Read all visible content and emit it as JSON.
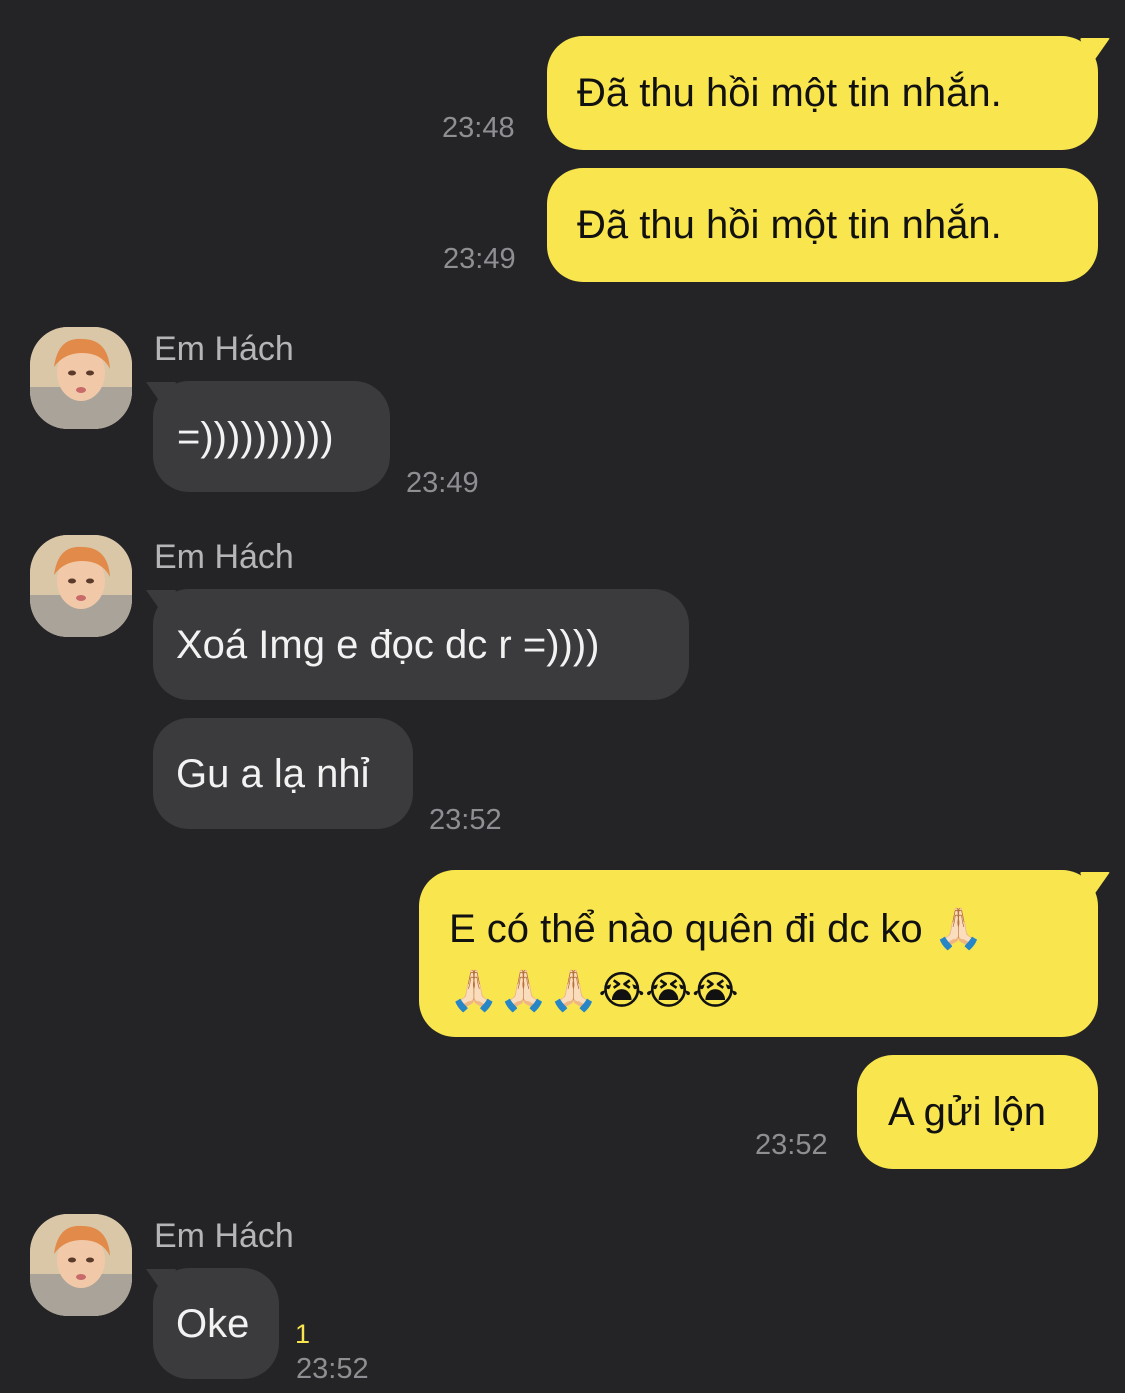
{
  "conversation": {
    "contact_name": "Em Hách",
    "messages": [
      {
        "direction": "out",
        "text": "Đã thu hồi một tin nhắn.",
        "time": "23:48"
      },
      {
        "direction": "out",
        "text": "Đã thu hồi một tin nhắn.",
        "time": "23:49"
      },
      {
        "direction": "in",
        "sender": "Em Hách",
        "text": "=))))))))))",
        "time": "23:49"
      },
      {
        "direction": "in",
        "sender": "Em Hách",
        "text": "Xoá Img e đọc dc r =))))"
      },
      {
        "direction": "in",
        "text": "Gu a lạ nhỉ",
        "time": "23:52"
      },
      {
        "direction": "out",
        "text_line1": "E có thể nào quên đi dc ko 🙏🏻",
        "text_line2": "🙏🏻🙏🏻🙏🏻😭😭😭"
      },
      {
        "direction": "out",
        "text": "A gửi lộn",
        "time": "23:52"
      },
      {
        "direction": "in",
        "sender": "Em Hách",
        "text": "Oke",
        "time": "23:52",
        "unread_count": "1"
      }
    ]
  },
  "colors": {
    "background": "#242426",
    "outgoing_bubble": "#F9E54E",
    "incoming_bubble": "#3B3B3D",
    "timestamp": "#8E8E93",
    "unread_indicator": "#F9E54E"
  },
  "icons": {
    "avatar": "contact-avatar-photo"
  }
}
